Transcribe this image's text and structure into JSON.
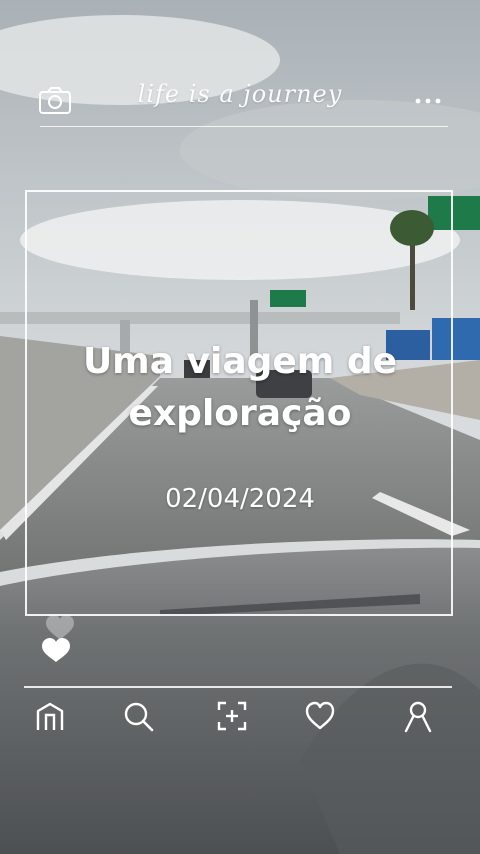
{
  "header": {
    "brand_text": "life is a journey",
    "camera_icon": "camera-icon",
    "more_icon": "more-dots-icon"
  },
  "card": {
    "title": "Uma viagem de exploração",
    "date": "02/04/2024"
  },
  "hearts_icon": "hearts-icon",
  "nav": {
    "items": [
      {
        "icon": "home-icon"
      },
      {
        "icon": "search-icon"
      },
      {
        "icon": "add-icon"
      },
      {
        "icon": "heart-icon"
      },
      {
        "icon": "profile-icon"
      }
    ]
  },
  "colors": {
    "overlay": "#ffffff",
    "sign_green": "#1f7a4a"
  }
}
